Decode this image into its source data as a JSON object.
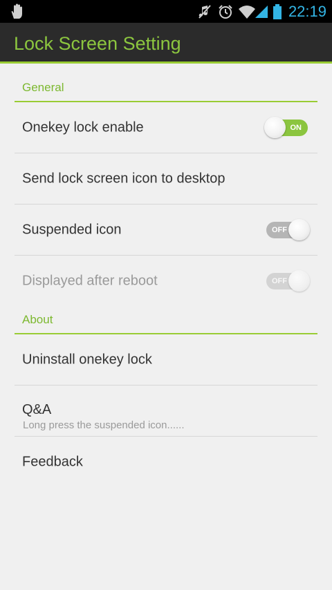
{
  "status_bar": {
    "time": "22:19",
    "icons": [
      "hand-icon",
      "mute-icon",
      "alarm-icon",
      "wifi-icon",
      "signal-icon",
      "battery-icon"
    ],
    "time_color": "#33b5e5"
  },
  "action_bar": {
    "title": "Lock Screen Setting"
  },
  "sections": {
    "general": {
      "header": "General",
      "items": [
        {
          "label": "Onekey lock enable",
          "toggle": "ON",
          "state": "on"
        },
        {
          "label": "Send lock screen icon to desktop"
        },
        {
          "label": "Suspended icon",
          "toggle": "OFF",
          "state": "off"
        },
        {
          "label": "Displayed after reboot",
          "toggle": "OFF",
          "state": "disabled"
        }
      ]
    },
    "about": {
      "header": "About",
      "items": [
        {
          "label": "Uninstall onekey lock"
        },
        {
          "label": "Q&A",
          "summary": "Long press the suspended icon......"
        },
        {
          "label": "Feedback"
        }
      ]
    }
  },
  "colors": {
    "accent": "#99cc33",
    "title_green": "#8cc63f",
    "toolbar": "#2b2b2b",
    "background": "#f0f0f0"
  }
}
